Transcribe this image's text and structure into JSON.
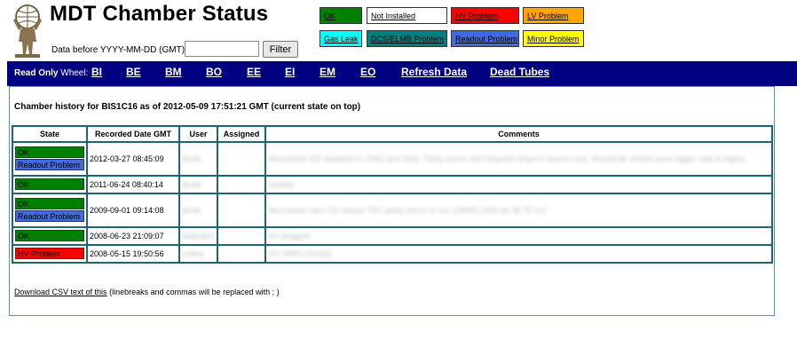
{
  "header": {
    "title": "MDT Chamber Status",
    "filter_label": "Data before YYYY-MM-DD (GMT):",
    "filter_value": "",
    "filter_button": "Filter"
  },
  "legend": [
    {
      "label": "OK",
      "color": "#008000",
      "text_color": "#000000"
    },
    {
      "label": "Not Installed",
      "color": "#ffffff",
      "text_color": "#000000"
    },
    {
      "label": "HV Problem",
      "color": "#ff0000",
      "text_color": "#000000"
    },
    {
      "label": "LV Problem",
      "color": "#ffa500",
      "text_color": "#000000"
    },
    {
      "label": "Gas Leak",
      "color": "#00ffff",
      "text_color": "#000000"
    },
    {
      "label": "DCS/ELMB Problem",
      "color": "#008080",
      "text_color": "#000000"
    },
    {
      "label": "Readout Problem",
      "color": "#4169e1",
      "text_color": "#000000"
    },
    {
      "label": "Minor Problem",
      "color": "#ffff00",
      "text_color": "#000000"
    }
  ],
  "nav": {
    "mode_label": "Read Only",
    "wheel_label": "Wheel:",
    "wheels": [
      "BI",
      "BE",
      "BM",
      "BO",
      "EE",
      "EI",
      "EM",
      "EO"
    ],
    "refresh": "Refresh Data",
    "dead_tubes": "Dead Tubes",
    "bg_color": "#000080"
  },
  "history": {
    "heading": "Chamber history for BIS1C16 as of 2012-05-09 17:51:21 GMT (current state on top)",
    "columns": [
      "State",
      "Recorded Date GMT",
      "User",
      "Assigned",
      "Comments"
    ],
    "rows": [
      {
        "states": [
          "OK",
          "Readout Problem"
        ],
        "date": "2012-03-27 08:45:09",
        "user": "jkode",
        "assigned": "",
        "comment": "Mezzanine #11 disabled in JTAG and DAQ. Parity errors and frequent drops in recent runs. Should be retried once trigger rate is higher."
      },
      {
        "states": [
          "OK"
        ],
        "date": "2011-06-24 08:40:14",
        "user": "jkode",
        "assigned": "",
        "comment": "Update"
      },
      {
        "states": [
          "OK",
          "Readout Problem"
        ],
        "date": "2009-09-01 09:14:08",
        "user": "jkode",
        "assigned": "",
        "comment": "Mezzanine card #11 shows TDC parity errors in run 129982 (100 mb @ 75 Hz)"
      },
      {
        "states": [
          "OK"
        ],
        "date": "2008-06-23 21:09:07",
        "user": "ankout01",
        "assigned": "",
        "comment": "HV plugged"
      },
      {
        "states": [
          "HV Problem"
        ],
        "date": "2008-05-15 19:50:56",
        "user": "nolkre",
        "assigned": "",
        "comment": "HV UNPLUGGED"
      }
    ],
    "download_link": "Download CSV text of this",
    "download_note": "(linebreaks and commas will be replaced with ; )"
  }
}
